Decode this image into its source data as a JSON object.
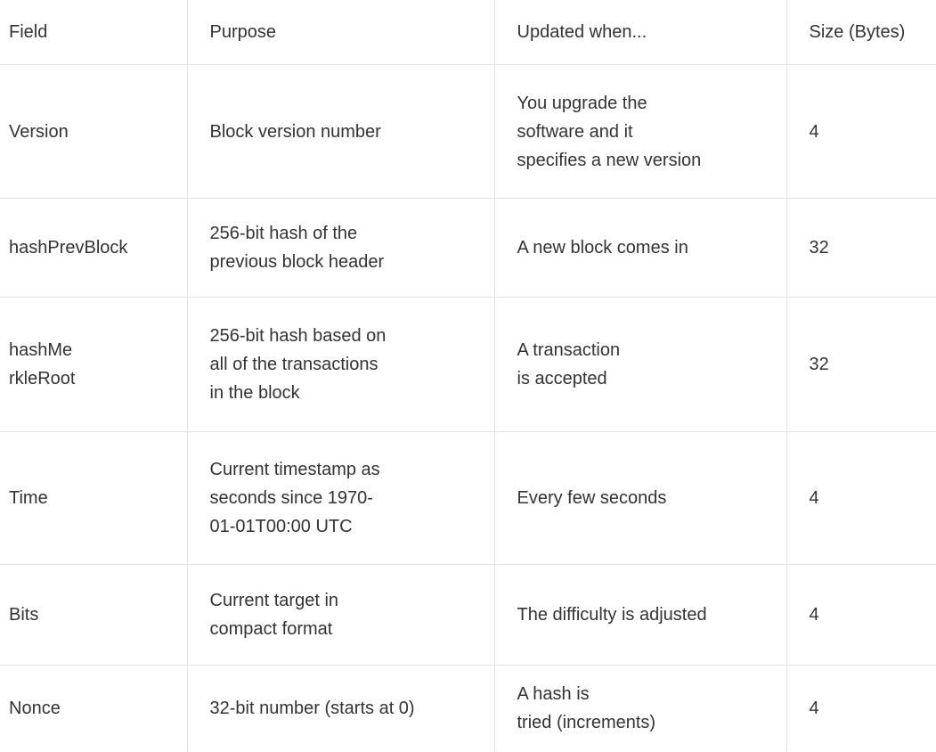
{
  "table": {
    "headers": [
      "Field",
      "Purpose",
      "Updated when...",
      "Size (Bytes)"
    ],
    "rows": [
      {
        "field": "Version",
        "purpose": "Block version number",
        "updated": "You upgrade the\nsoftware and it\nspecifies a new version",
        "size": "4"
      },
      {
        "field": "hashPrevBlock",
        "purpose": "256-bit hash of the\nprevious block header",
        "updated": "A new block comes in",
        "size": "32"
      },
      {
        "field": "hashMe\nrkleRoot",
        "purpose": "256-bit hash based on\nall of the transactions\nin the block",
        "updated": "A transaction\nis accepted",
        "size": "32"
      },
      {
        "field": "Time",
        "purpose": "Current timestamp as\nseconds since 1970-\n01-01T00:00 UTC",
        "updated": "Every few seconds",
        "size": "4"
      },
      {
        "field": "Bits",
        "purpose": "Current target in\ncompact format",
        "updated": "The difficulty is adjusted",
        "size": "4"
      },
      {
        "field": "Nonce",
        "purpose": "32-bit number (starts at 0)",
        "updated": "A hash is\ntried (increments)",
        "size": "4"
      }
    ]
  }
}
